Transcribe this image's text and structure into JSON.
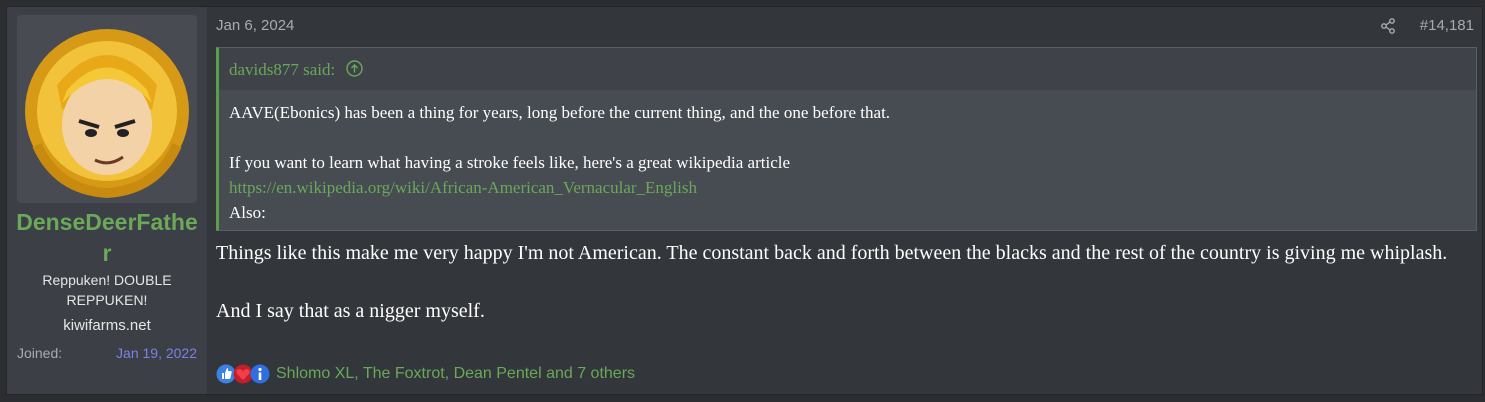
{
  "user": {
    "name": "DenseDeerFather",
    "title": "Reppuken! DOUBLE REPPUKEN!",
    "banner": "kiwifarms.net",
    "joined_label": "Joined:",
    "joined_value": "Jan 19, 2022",
    "avatar_icon": "anime-avatar-icon"
  },
  "post": {
    "date": "Jan 6, 2024",
    "number": "#14,181",
    "share_icon": "share-icon"
  },
  "quote": {
    "author": "davids877 said:",
    "line1": "AAVE(Ebonics) has been a thing for years, long before the current thing, and the one before that.",
    "line2": "If you want to learn what having a stroke feels like, here's a great wikipedia article",
    "link": "https://en.wikipedia.org/wiki/African-American_Vernacular_English",
    "line3": "Also:"
  },
  "message": {
    "para1": "Things like this make me very happy I'm not American. The constant back and forth between the blacks and the rest of the country is giving me whiplash.",
    "para2": "And I say that as a nigger myself."
  },
  "reactions": {
    "text": "Shlomo XL, The Foxtrot, Dean Pentel and 7 others",
    "icons": [
      "thumbs-up-icon",
      "heart-shield-icon",
      "info-icon"
    ]
  },
  "colors": {
    "username": "#6aa85a",
    "link": "#6aa85a",
    "joined": "#7b82e6"
  }
}
